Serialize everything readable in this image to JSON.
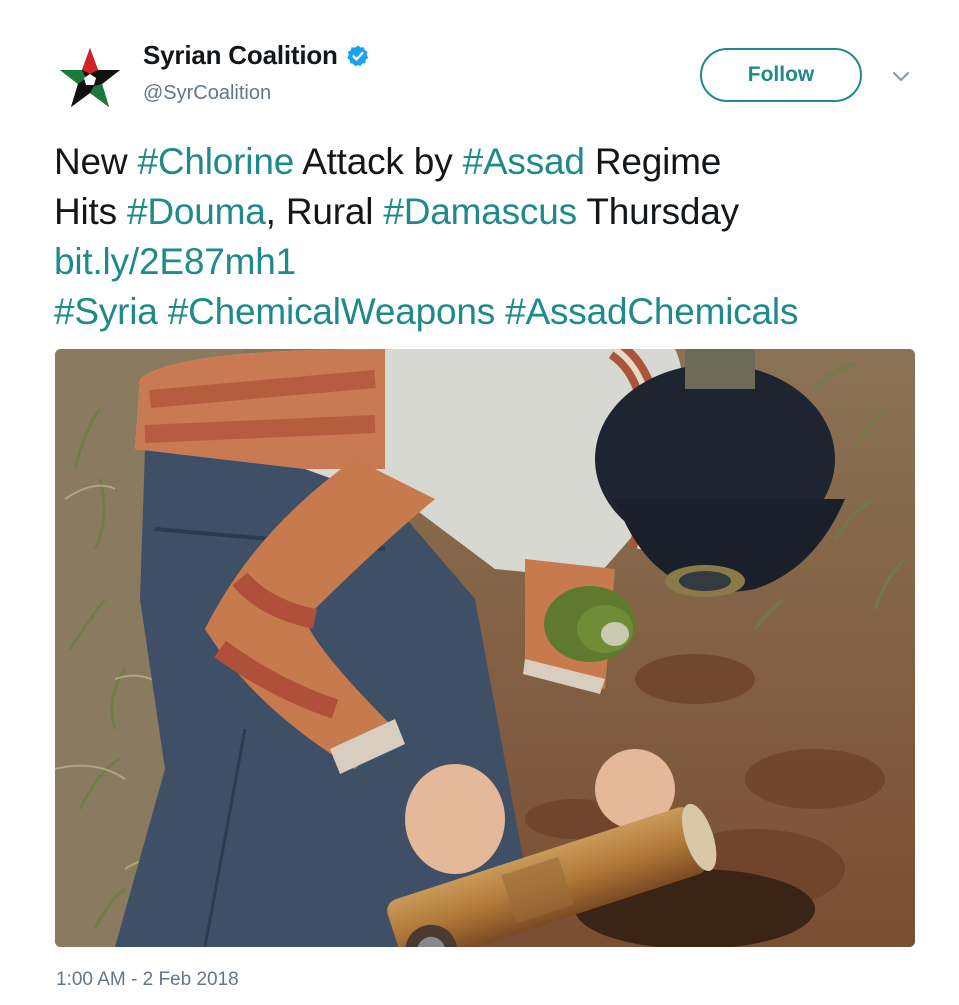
{
  "account": {
    "display_name": "Syrian Coalition",
    "handle": "@SyrCoalition",
    "verified_icon": "verified-badge-icon",
    "avatar_icon": "syrian-coalition-star-logo"
  },
  "actions": {
    "follow_label": "Follow",
    "menu_icon": "chevron-down-icon"
  },
  "tweet": {
    "line1": [
      {
        "text": "New ",
        "type": "text"
      },
      {
        "text": "#Chlorine",
        "type": "tag"
      },
      {
        "text": " Attack by ",
        "type": "text"
      },
      {
        "text": "#Assad",
        "type": "tag"
      },
      {
        "text": " Regime",
        "type": "text"
      }
    ],
    "line2": [
      {
        "text": "Hits ",
        "type": "text"
      },
      {
        "text": "#Douma",
        "type": "tag"
      },
      {
        "text": ", Rural ",
        "type": "text"
      },
      {
        "text": "#Damascus",
        "type": "tag"
      },
      {
        "text": " Thursday",
        "type": "text"
      }
    ],
    "link": "bit.ly/2E87mh1",
    "hashtags": [
      "#Syria",
      "#ChemicalWeapons",
      "#AssadChemicals"
    ],
    "timestamp": "1:00 AM - 2 Feb 2018"
  },
  "colors": {
    "accent": "#1e8a8a",
    "text": "#14171a",
    "muted": "#657786",
    "verified": "#1da1f2"
  }
}
